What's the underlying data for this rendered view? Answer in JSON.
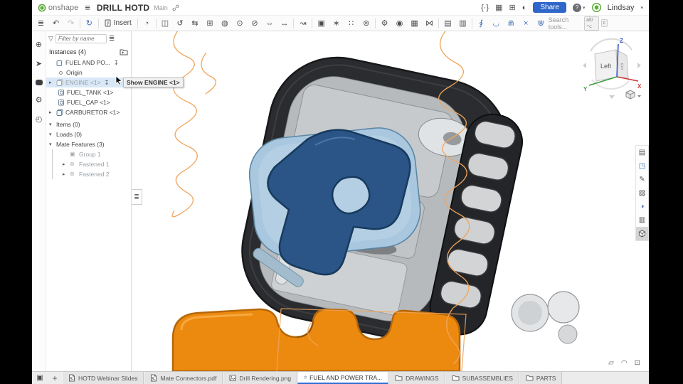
{
  "brand": {
    "name": "onshape",
    "user": "Lindsay"
  },
  "top_bar": {
    "title": "DRILL HOTD",
    "workspace": "Main",
    "share_label": "Share",
    "help_label": "?"
  },
  "toolbar": {
    "insert_label": "Insert",
    "search_label": "Search tools...",
    "shortcut_alt": "alt/⌥",
    "shortcut_key": "c"
  },
  "left_panel": {
    "filter_placeholder": "Filter by name",
    "header": "Instances (4)",
    "tree": [
      {
        "label": "FUEL AND PO...",
        "type": "assembly"
      },
      {
        "label": "Origin",
        "type": "origin"
      },
      {
        "label": "ENGINE <1>",
        "type": "assembly",
        "state": "hidden-highlighted"
      },
      {
        "label": "FUEL_TANK <1>",
        "type": "part"
      },
      {
        "label": "FUEL_CAP <1>",
        "type": "part"
      },
      {
        "label": "CARBURETOR <1>",
        "type": "assembly"
      }
    ],
    "sections": [
      {
        "label": "Items (0)"
      },
      {
        "label": "Loads (0)"
      },
      {
        "label": "Mate Features (3)"
      }
    ],
    "mate_features": [
      {
        "label": "Group 1"
      },
      {
        "label": "Fastened 1"
      },
      {
        "label": "Fastened 2"
      }
    ]
  },
  "tooltip": "Show ENGINE <1>",
  "view_cube": {
    "left_face": "Left",
    "front_face": "Fro",
    "x": "X",
    "y": "Y",
    "z": "Z"
  },
  "tabs": [
    {
      "label": "HOTD Webinar Slides",
      "type": "pdf",
      "active": false
    },
    {
      "label": "Mate Connectors.pdf",
      "type": "pdf",
      "active": false
    },
    {
      "label": "Drill Rendering.png",
      "type": "image",
      "active": false
    },
    {
      "label": "FUEL AND POWER TRA...",
      "type": "assembly",
      "active": true
    },
    {
      "label": "DRAWINGS",
      "type": "folder",
      "active": false
    },
    {
      "label": "SUBASSEMBLIES",
      "type": "folder",
      "active": false
    },
    {
      "label": "PARTS",
      "type": "folder",
      "active": false
    }
  ],
  "icons": {
    "hamburger": "≡",
    "versions": "{·}",
    "spreadsheet": "▦",
    "apps": "⊞",
    "globe": "◐",
    "caret": "▾",
    "tree": "≣",
    "undo": "↶",
    "redo": "↷",
    "sync": "↻",
    "history": "◔",
    "mate": "◫",
    "revolute": "↺",
    "slider": "⇆",
    "planar": "⊞",
    "ball": "◍",
    "cylindrical": "⊙",
    "pin_slot": "⊘",
    "translate": "⇔",
    "width": "↔",
    "snap": "↝",
    "group": "▣",
    "replicate": "∗",
    "pattern": "∷",
    "mate_connector": "⊚",
    "gear": "⚙",
    "configurations": "◉",
    "in_context": "▦",
    "exploded": "⋈",
    "named_positions": "⊕",
    "sheet": "▤",
    "bom": "▥",
    "sim1": "∮",
    "sim2": "◡",
    "sim3": "⋒",
    "sim4": "×",
    "sim5": "⋓",
    "variables": "⊕",
    "markup": "➤",
    "stopwatch": "◴",
    "funnel": "▽",
    "list": "≣",
    "download": "↧",
    "chev_right": "▸",
    "chev_down": "▾",
    "rs_notes": "▤",
    "rs_appearance": "◳",
    "rs_edit": "✎",
    "rs_section": "▨",
    "rs_views": "◑",
    "rs_bracket": "▥",
    "br_print": "▱",
    "br_gauge": "◠",
    "br_export": "⊡",
    "tab_mgr": "▣",
    "tab_add": "+",
    "collapse": "≣"
  },
  "colors": {
    "share_blue": "#2e66c9",
    "accent": "#2e6fd6",
    "highlight_row": "#d9e8f7",
    "onshape_green": "#5fae3e",
    "housing_dark": "#2b2c2f",
    "cover_blue": "#a9c7de",
    "logo_navy": "#2a5586",
    "tank_orange": "#ec8a10",
    "sketch_orange": "#efa55b"
  }
}
